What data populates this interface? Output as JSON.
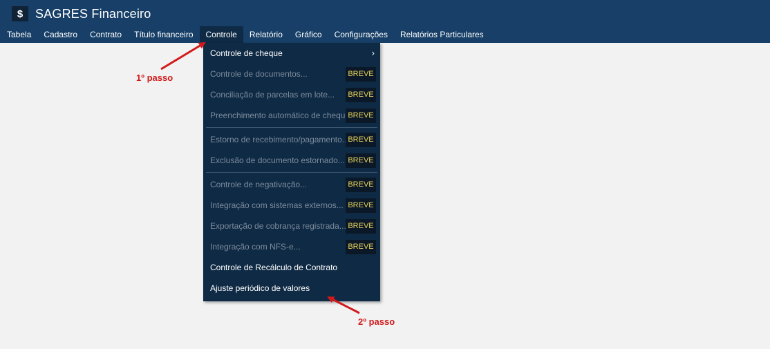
{
  "app": {
    "logo_symbol": "$",
    "title": "SAGRES Financeiro"
  },
  "menu": [
    {
      "label": "Tabela",
      "active": false
    },
    {
      "label": "Cadastro",
      "active": false
    },
    {
      "label": "Contrato",
      "active": false
    },
    {
      "label": "Título financeiro",
      "active": false
    },
    {
      "label": "Controle",
      "active": true
    },
    {
      "label": "Relatório",
      "active": false
    },
    {
      "label": "Gráfico",
      "active": false
    },
    {
      "label": "Configurações",
      "active": false
    },
    {
      "label": "Relatórios Particulares",
      "active": false
    }
  ],
  "dropdown": {
    "submenu_arrow": "›",
    "items": [
      {
        "label": "Controle de cheque",
        "enabled": true,
        "submenu": true
      },
      {
        "label": "Controle de documentos...",
        "enabled": false,
        "badge": "BREVE"
      },
      {
        "label": "Conciliação de parcelas em lote...",
        "enabled": false,
        "badge": "BREVE"
      },
      {
        "label": "Preenchimento automático de cheque...",
        "enabled": false,
        "badge": "BREVE",
        "separator_after": true
      },
      {
        "label": "Estorno de recebimento/pagamento...",
        "enabled": false,
        "badge": "BREVE"
      },
      {
        "label": "Exclusão de documento estornado...",
        "enabled": false,
        "badge": "BREVE",
        "separator_after": true
      },
      {
        "label": "Controle de negativação...",
        "enabled": false,
        "badge": "BREVE"
      },
      {
        "label": "Integração com sistemas externos...",
        "enabled": false,
        "badge": "BREVE"
      },
      {
        "label": "Exportação de cobrança registrada...",
        "enabled": false,
        "badge": "BREVE"
      },
      {
        "label": "Integração com NFS-e...",
        "enabled": false,
        "badge": "BREVE"
      },
      {
        "label": "Controle de Recálculo de Contrato",
        "enabled": true
      },
      {
        "label": "Ajuste periódico de valores",
        "enabled": true
      }
    ]
  },
  "annotations": {
    "step1": "1º passo",
    "step2": "2º passo",
    "color": "#d11a1a"
  },
  "colors": {
    "topbar": "#173f67",
    "menu_active": "#0e2a45",
    "dropdown_bg": "#0f2a45",
    "badge_bg": "#0a1828",
    "badge_text": "#e8d25a",
    "page_bg": "#f2f2f2"
  }
}
